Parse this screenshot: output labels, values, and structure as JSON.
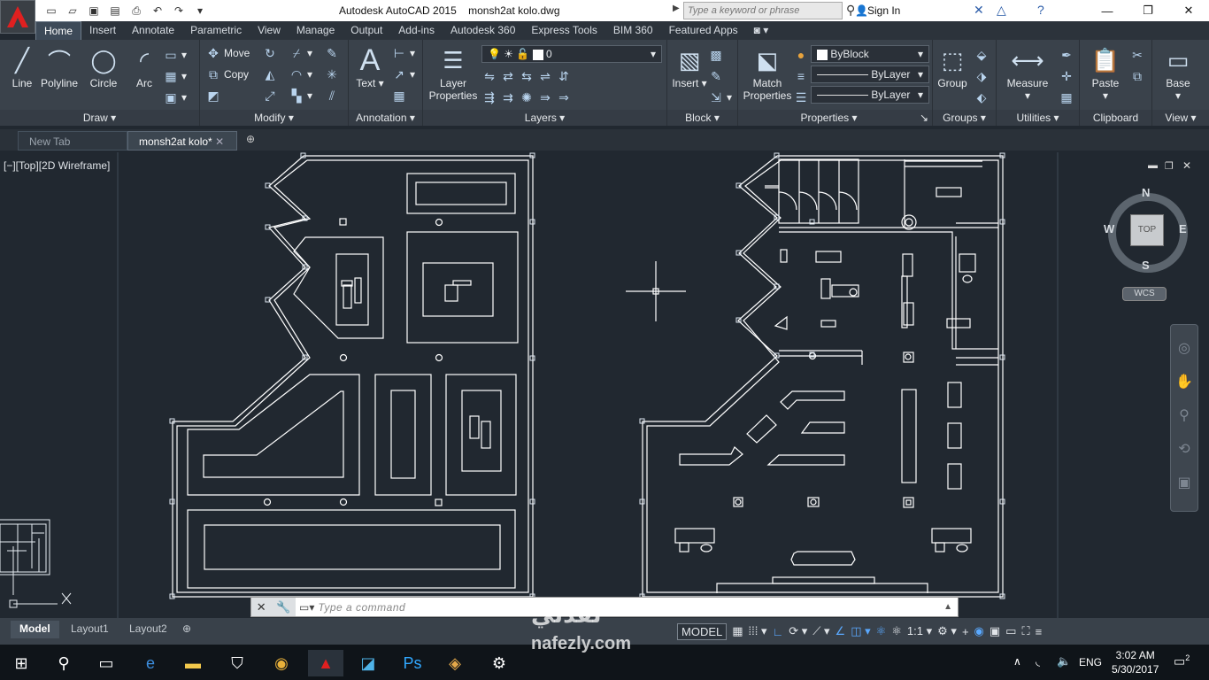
{
  "window": {
    "app_name": "Autodesk AutoCAD 2015",
    "file_name": "monsh2at kolo.dwg",
    "search_placeholder": "Type a keyword or phrase",
    "sign_in": "Sign In"
  },
  "ribbon": {
    "tabs": [
      "Home",
      "Insert",
      "Annotate",
      "Parametric",
      "View",
      "Manage",
      "Output",
      "Add-ins",
      "Autodesk 360",
      "Express Tools",
      "BIM 360",
      "Featured Apps"
    ],
    "active_tab": "Home",
    "draw": {
      "title": "Draw",
      "line": "Line",
      "polyline": "Polyline",
      "circle": "Circle",
      "arc": "Arc"
    },
    "modify": {
      "title": "Modify",
      "move": "Move",
      "copy": "Copy"
    },
    "annotation": {
      "title": "Annotation",
      "text": "Text"
    },
    "layers": {
      "title": "Layers",
      "layer_properties_1": "Layer",
      "layer_properties_2": "Properties",
      "current_layer": "0"
    },
    "block": {
      "title": "Block",
      "insert": "Insert"
    },
    "properties": {
      "title": "Properties",
      "match_1": "Match",
      "match_2": "Properties",
      "color": "ByBlock",
      "linetype": "ByLayer",
      "lineweight": "ByLayer"
    },
    "groups": {
      "title": "Groups",
      "group": "Group"
    },
    "utilities": {
      "title": "Utilities",
      "measure": "Measure"
    },
    "clipboard": {
      "title": "Clipboard",
      "paste": "Paste"
    },
    "view": {
      "title": "View",
      "base": "Base"
    }
  },
  "doc_tabs": {
    "new_tab": "New Tab",
    "current": "monsh2at kolo*"
  },
  "viewport": {
    "label": "[−][Top][2D Wireframe]",
    "compass": {
      "n": "N",
      "s": "S",
      "e": "E",
      "w": "W",
      "top": "TOP",
      "wcs": "WCS"
    }
  },
  "command": {
    "placeholder": "Type a command"
  },
  "layout_tabs": [
    "Model",
    "Layout1",
    "Layout2"
  ],
  "status": {
    "model": "MODEL",
    "scale": "1:1"
  },
  "taskbar": {
    "lang": "ENG",
    "time": "3:02 AM",
    "date": "5/30/2017",
    "notifications": "2"
  },
  "watermark": {
    "line1": "نفذلي",
    "line2": "nafezly.com"
  }
}
